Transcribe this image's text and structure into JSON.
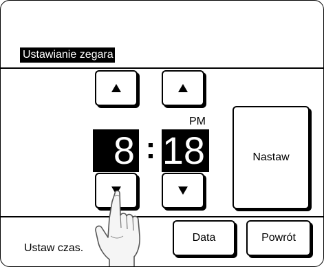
{
  "screen": {
    "title": "Ustawianie zegara",
    "status_text": "Ustaw czas."
  },
  "clock": {
    "hour": "8",
    "separator": ":",
    "minute": "18",
    "ampm": "PM"
  },
  "buttons": {
    "hour_up": "up-arrow-icon",
    "hour_down": "down-arrow-icon",
    "minute_up": "up-arrow-icon",
    "minute_down": "down-arrow-icon",
    "set_label": "Nastaw",
    "date_label": "Data",
    "back_label": "Powrót"
  }
}
